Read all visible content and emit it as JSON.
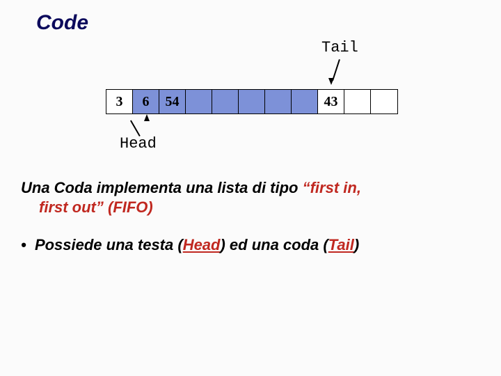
{
  "title": "Code",
  "labels": {
    "tail": "Tail",
    "head": "Head"
  },
  "cells": [
    {
      "value": "3",
      "class": "first"
    },
    {
      "value": "6",
      "class": ""
    },
    {
      "value": "54",
      "class": ""
    },
    {
      "value": "",
      "class": ""
    },
    {
      "value": "",
      "class": ""
    },
    {
      "value": "",
      "class": ""
    },
    {
      "value": "",
      "class": ""
    },
    {
      "value": "",
      "class": ""
    },
    {
      "value": "43",
      "class": "empty"
    },
    {
      "value": "",
      "class": "empty"
    },
    {
      "value": "",
      "class": "empty"
    }
  ],
  "text": {
    "p1a": "Una Coda implementa una lista di tipo ",
    "p1b": "“first in,",
    "p1c": "first out” (FIFO)",
    "p2a": "Possiede una testa (",
    "p2b": "Head",
    "p2c": ") ed una coda (",
    "p2d": "Tail",
    "p2e": ")"
  }
}
